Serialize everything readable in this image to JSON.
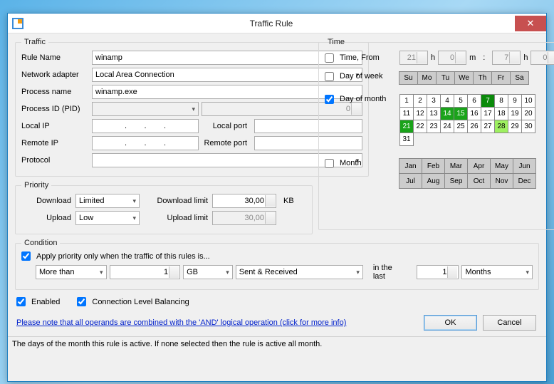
{
  "window": {
    "title": "Traffic Rule"
  },
  "traffic": {
    "legend": "Traffic",
    "rule_name_label": "Rule Name",
    "rule_name": "winamp",
    "adapter_label": "Network adapter",
    "adapter": "Local Area Connection",
    "process_label": "Process name",
    "process": "winamp.exe",
    "pid_label": "Process ID (PID)",
    "pid_combo": "",
    "pid_spin": "0",
    "local_ip_label": "Local IP",
    "local_ip": ".        .        .",
    "local_port_label": "Local port",
    "local_port": "",
    "remote_ip_label": "Remote IP",
    "remote_ip": ".        .        .",
    "remote_port_label": "Remote port",
    "remote_port": "",
    "protocol_label": "Protocol",
    "protocol": ""
  },
  "priority": {
    "legend": "Priority",
    "dl_label": "Download",
    "dl_value": "Limited",
    "ul_label": "Upload",
    "ul_value": "Low",
    "dl_limit_label": "Download limit",
    "dl_limit": "30,00",
    "ul_limit_label": "Upload limit",
    "ul_limit": "30,00",
    "unit": "KB"
  },
  "time": {
    "legend": "Time",
    "from_label": "Time, From",
    "from_checked": false,
    "from_h": "21",
    "from_m": "0",
    "to_h": "7",
    "to_m": "0",
    "h": "h",
    "m": "m",
    "colon": ":",
    "dow_label": "Day of week",
    "dow_checked": false,
    "days": [
      "Su",
      "Mo",
      "Tu",
      "We",
      "Th",
      "Fr",
      "Sa"
    ],
    "dom_label": "Day of month",
    "dom_checked": true,
    "dom_cells": [
      {
        "n": "1"
      },
      {
        "n": "2"
      },
      {
        "n": "3"
      },
      {
        "n": "4"
      },
      {
        "n": "5"
      },
      {
        "n": "6"
      },
      {
        "n": "7",
        "cls": "sel-dark"
      },
      {
        "n": "8"
      },
      {
        "n": "9"
      },
      {
        "n": "10"
      },
      {
        "n": "11"
      },
      {
        "n": "12"
      },
      {
        "n": "13"
      },
      {
        "n": "14",
        "cls": "sel-mid"
      },
      {
        "n": "15",
        "cls": "sel-mid"
      },
      {
        "n": "16"
      },
      {
        "n": "17"
      },
      {
        "n": "18"
      },
      {
        "n": "19"
      },
      {
        "n": "20"
      },
      {
        "n": "21",
        "cls": "sel-mid"
      },
      {
        "n": "22"
      },
      {
        "n": "23"
      },
      {
        "n": "24"
      },
      {
        "n": "25"
      },
      {
        "n": "26"
      },
      {
        "n": "27"
      },
      {
        "n": "28",
        "cls": "sel-light"
      },
      {
        "n": "29"
      },
      {
        "n": "30"
      },
      {
        "n": "31"
      }
    ],
    "month_label": "Month",
    "month_checked": false,
    "months": [
      "Jan",
      "Feb",
      "Mar",
      "Apr",
      "May",
      "Jun",
      "Jul",
      "Aug",
      "Sep",
      "Oct",
      "Nov",
      "Dec"
    ]
  },
  "cond": {
    "legend": "Condition",
    "apply_label": "Apply priority only when the traffic of this rules is...",
    "apply_checked": true,
    "op": "More than",
    "val": "1",
    "unit": "GB",
    "dir": "Sent & Received",
    "in_last": "in the last",
    "n": "1",
    "period": "Months"
  },
  "opts": {
    "enabled_label": "Enabled",
    "enabled": true,
    "clb_label": "Connection Level Balancing",
    "clb": true
  },
  "note": "Please note that all operands are combined with the 'AND' logical operation (click for more info)",
  "buttons": {
    "ok": "OK",
    "cancel": "Cancel"
  },
  "status": "The days of the month this rule is active. If none selected then the rule is active all month."
}
